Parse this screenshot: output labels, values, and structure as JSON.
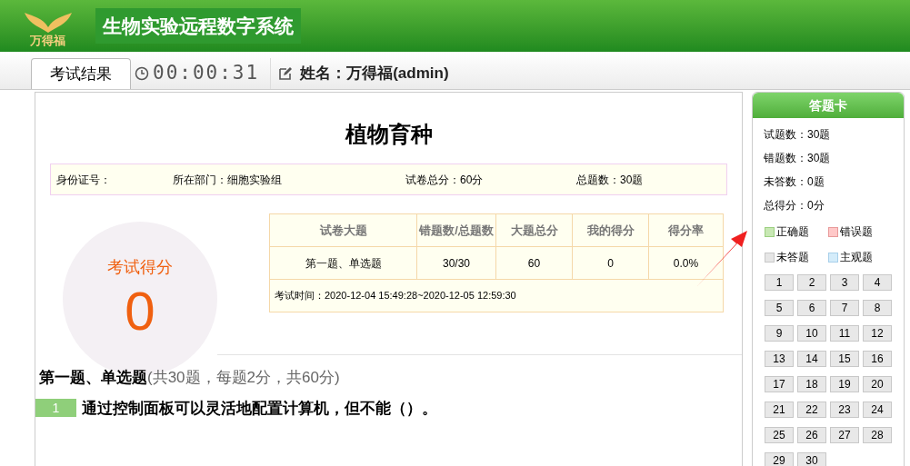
{
  "header": {
    "brand": "万得福",
    "title": "生物实验远程数字系统"
  },
  "toolbar": {
    "tabs": [
      {
        "label": "考试结果",
        "selected": true
      }
    ],
    "timer": "00:00:31",
    "user": "姓名：万得福(admin)"
  },
  "exam": {
    "title": "植物育种",
    "info": [
      "身份证号：",
      "所在部门：细胞实验组",
      "试卷总分：60分",
      "总题数：30题"
    ],
    "score_label": "考试得分",
    "score": "0",
    "table": {
      "columns": [
        "试卷大题",
        "错题数/总题数",
        "大题总分",
        "我的得分",
        "得分率"
      ],
      "rows": [
        [
          "第一题、单选题",
          "30/30",
          "60",
          "0",
          "0.0%"
        ]
      ],
      "footer": "考试时间：2020-12-04 15:49:28~2020-12-05 12:59:30"
    },
    "section": {
      "title": "第一题、单选题",
      "note": "(共30题，每题2分，共60分)"
    },
    "question": {
      "number": "1",
      "text": "通过控制面板可以灵活地配置计算机，但不能（）。"
    }
  },
  "answer_card": {
    "title": "答题卡",
    "stats": [
      "试题数：30题",
      "错题数：30题",
      "未答数：0题",
      "总得分：0分"
    ],
    "legend": [
      {
        "label": "正确题",
        "color": "#c8e8b4"
      },
      {
        "label": "错误题",
        "color": "#ffc8c8"
      },
      {
        "label": "未答题",
        "color": "#e6e6e6"
      },
      {
        "label": "主观题",
        "color": "#d4ecfa"
      }
    ],
    "questions": [
      "1",
      "2",
      "3",
      "4",
      "5",
      "6",
      "7",
      "8",
      "9",
      "10",
      "11",
      "12",
      "13",
      "14",
      "15",
      "16",
      "17",
      "18",
      "19",
      "20",
      "21",
      "22",
      "23",
      "24",
      "25",
      "26",
      "27",
      "28",
      "29",
      "30"
    ]
  }
}
